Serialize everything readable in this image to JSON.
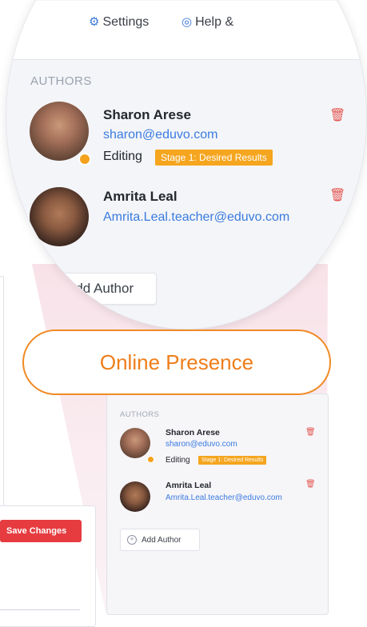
{
  "top_nav": {
    "settings_label": "Settings",
    "settings_icon": "gear-icon",
    "help_label": "Help & ",
    "help_icon": "lifebuoy-icon"
  },
  "authors_panel": {
    "section_label": "AUTHORS",
    "authors": [
      {
        "name": "Sharon Arese",
        "email": "sharon@eduvo.com",
        "status": "Editing",
        "badge": "Stage 1: Desired Results",
        "online": true
      },
      {
        "name": "Amrita Leal",
        "email": "Amrita.Leal.teacher@eduvo.com",
        "status": "",
        "badge": "",
        "online": false
      }
    ],
    "add_author_label": "Add Author"
  },
  "callout": {
    "text": "Online Presence"
  },
  "save_changes_label": "Save Changes",
  "colors": {
    "accent_orange": "#f08a24",
    "badge": "#f5a51e",
    "link_blue": "#3a7be0",
    "danger": "#e63c40"
  }
}
